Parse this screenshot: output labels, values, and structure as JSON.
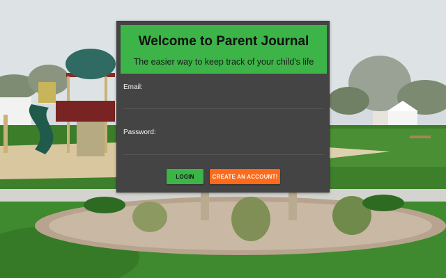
{
  "header": {
    "title": "Welcome to Parent Journal",
    "subtitle": "The easier way to keep track of your child's life"
  },
  "form": {
    "email_label": "Email:",
    "email_value": "",
    "password_label": "Password:",
    "password_value": ""
  },
  "actions": {
    "login_label": "LOGIN",
    "create_account_label": "CREATE AN ACCOUNT!"
  },
  "colors": {
    "header_green": "#3cb448",
    "card_bg": "#444444",
    "login_button": "#3cb448",
    "create_button": "#ff6a1a"
  },
  "background": {
    "scene": "park-playground-photo"
  }
}
